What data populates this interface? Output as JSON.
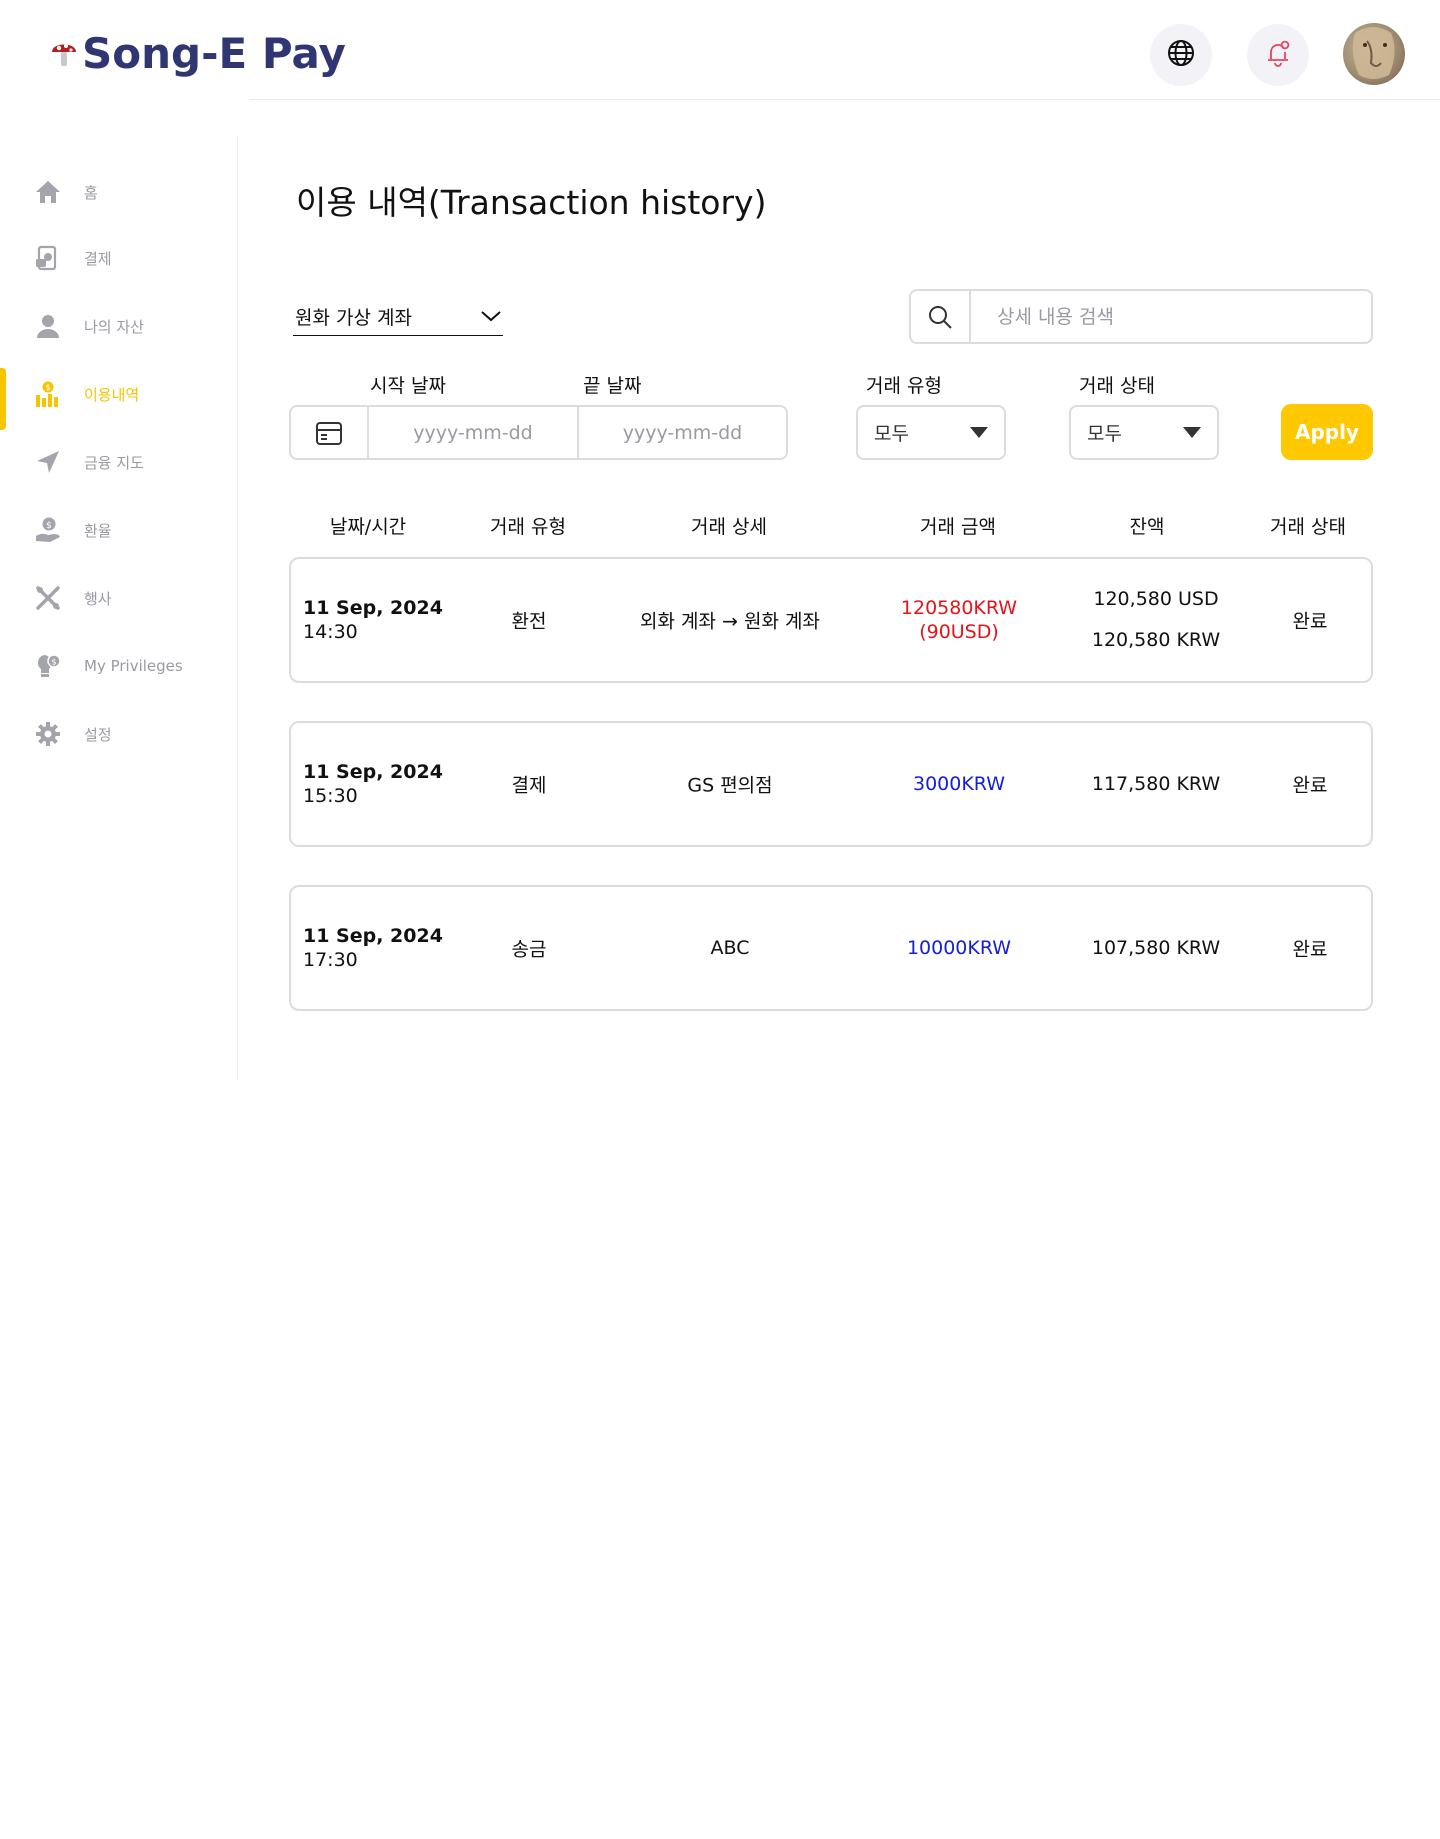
{
  "brand": {
    "name": "Song-E Pay"
  },
  "header": {
    "language_icon": "globe-icon",
    "notification_icon": "bell-icon",
    "avatar_alt": "avatar"
  },
  "sidebar": {
    "items": [
      {
        "label": "홈",
        "icon": "home-icon",
        "active": false
      },
      {
        "label": "결제",
        "icon": "payment-icon",
        "active": false
      },
      {
        "label": "나의 자산",
        "icon": "user-icon",
        "active": false
      },
      {
        "label": "이용내역",
        "icon": "history-icon",
        "active": true
      },
      {
        "label": "금융 지도",
        "icon": "navigation-icon",
        "active": false
      },
      {
        "label": "환율",
        "icon": "exchange-icon",
        "active": false
      },
      {
        "label": "행사",
        "icon": "tools-icon",
        "active": false
      },
      {
        "label": "My Privileges",
        "icon": "privilege-icon",
        "active": false
      },
      {
        "label": "설정",
        "icon": "gear-icon",
        "active": false
      }
    ]
  },
  "page": {
    "title": "이용 내역(Transaction history)"
  },
  "filters": {
    "account_select": "원화 가상 계좌",
    "search_placeholder": "상세 내용 검색",
    "start_date_label": "시작 날짜",
    "end_date_label": "끝 날짜",
    "date_placeholder": "yyyy-mm-dd",
    "type_label": "거래 유형",
    "type_value": "모두",
    "status_label": "거래 상태",
    "status_value": "모두",
    "apply_label": "Apply"
  },
  "table": {
    "headers": [
      "날짜/시간",
      "거래 유형",
      "거래 상세",
      "거래 금액",
      "잔액",
      "거래 상태"
    ],
    "rows": [
      {
        "date": "11 Sep, 2024",
        "time": "14:30",
        "type": "환전",
        "detail": "외화 계좌 → 원화 계좌",
        "amount": "120580KRW",
        "amount_sub": "(90USD)",
        "amount_color": "#e5141b",
        "balance": "120,580 USD",
        "balance_sub": "120,580 KRW",
        "status": "완료"
      },
      {
        "date": "11 Sep, 2024",
        "time": "15:30",
        "type": "결제",
        "detail": "GS 편의점",
        "amount": "3000KRW",
        "amount_color": "#1420d6",
        "balance": "117,580 KRW",
        "status": "완료"
      },
      {
        "date": "11 Sep, 2024",
        "time": "17:30",
        "type": "송금",
        "detail": "ABC",
        "amount": "10000KRW",
        "amount_color": "#1420d6",
        "balance": "107,580 KRW",
        "status": "완료"
      }
    ]
  },
  "colors": {
    "accent": "#ffc800",
    "brand": "#2f3672",
    "debit": "#1420d6",
    "exchange": "#e5141b"
  }
}
